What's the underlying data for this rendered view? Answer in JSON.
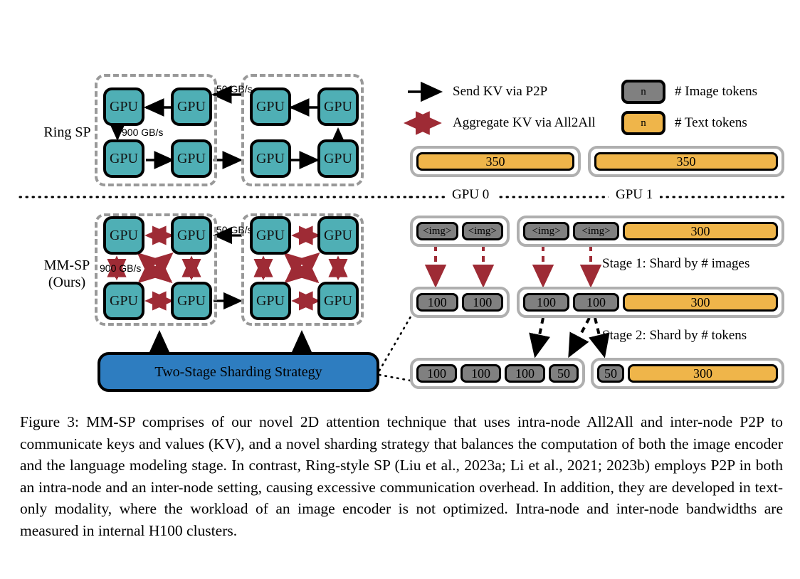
{
  "figure": {
    "rows": [
      {
        "id": "ring",
        "label_line1": "Ring SP",
        "label_line2": ""
      },
      {
        "id": "mmsp",
        "label_line1": "MM-SP",
        "label_line2": "(Ours)"
      }
    ],
    "gpu_label": "GPU",
    "bandwidth": {
      "inter_node": "50 GB/s",
      "intra_node": "900 GB/s"
    },
    "blue_box_label": "Two-Stage Sharding Strategy"
  },
  "legend": {
    "items": [
      {
        "icon": "arrow-right-black",
        "label": "Send KV via P2P"
      },
      {
        "icon": "arrow-double-red",
        "label": "Aggregate KV via All2All"
      }
    ],
    "chips": [
      {
        "icon": "gray-chip",
        "value": "n",
        "label": "# Image tokens",
        "color": "#808080"
      },
      {
        "icon": "orange-chip",
        "value": "n",
        "label": "# Text tokens",
        "color": "#EFB54A"
      }
    ]
  },
  "tokens": {
    "gpu_captions": [
      "GPU 0",
      "GPU 1"
    ],
    "ring_row": {
      "gpu0": [
        {
          "type": "text",
          "value": "350"
        }
      ],
      "gpu1": [
        {
          "type": "text",
          "value": "350"
        }
      ]
    },
    "stage1": {
      "caption": "Stage 1: Shard by # images",
      "gpu0": [
        {
          "type": "image",
          "value": "<img>"
        },
        {
          "type": "image",
          "value": "<img>"
        }
      ],
      "gpu1": [
        {
          "type": "image",
          "value": "<img>"
        },
        {
          "type": "image",
          "value": "<img>"
        },
        {
          "type": "text",
          "value": "300"
        }
      ]
    },
    "stage1_result": {
      "gpu0": [
        {
          "type": "image",
          "value": "100"
        },
        {
          "type": "image",
          "value": "100"
        }
      ],
      "gpu1": [
        {
          "type": "image",
          "value": "100"
        },
        {
          "type": "image",
          "value": "100"
        },
        {
          "type": "text",
          "value": "300"
        }
      ]
    },
    "stage2": {
      "caption": "Stage 2: Shard by # tokens",
      "gpu0": [
        {
          "type": "image",
          "value": "100"
        },
        {
          "type": "image",
          "value": "100"
        },
        {
          "type": "image",
          "value": "100"
        },
        {
          "type": "image",
          "value": "50"
        }
      ],
      "gpu1": [
        {
          "type": "image",
          "value": "50"
        },
        {
          "type": "text",
          "value": "300"
        }
      ]
    }
  },
  "colors": {
    "gpu": "#4FAFB5",
    "image_token": "#808080",
    "text_token": "#EFB54A",
    "blue_box": "#2E7DC0",
    "all2all_arrow": "#9E2B35",
    "node_border": "#999999",
    "shell_border": "#AFAFAF"
  },
  "caption": {
    "text": "Figure 3: MM-SP comprises of our novel 2D attention technique that uses intra-node All2All and inter-node P2P to communicate keys and values (KV), and a novel sharding strategy that balances the computation of both the image encoder and the language modeling stage. In contrast, Ring-style SP (Liu et al., 2023a; Li et al., 2021; 2023b) employs P2P in both an intra-node and an inter-node setting, causing excessive communication overhead.  In addition, they are developed in text-only modality, where the workload of an image encoder is not optimized.  Intra-node and inter-node bandwidths are measured in internal H100 clusters."
  }
}
